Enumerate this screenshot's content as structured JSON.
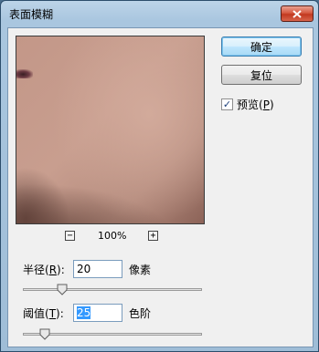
{
  "window": {
    "title": "表面模糊",
    "close_icon": "close-icon"
  },
  "preview": {
    "zoom_level": "100%",
    "zoom_out_label": "−",
    "zoom_in_label": "+"
  },
  "buttons": {
    "ok_label": "确定",
    "reset_label": "复位"
  },
  "preview_checkbox": {
    "label_prefix": "预览(",
    "mnemonic": "P",
    "label_suffix": ")",
    "checked": true
  },
  "radius": {
    "label_prefix": "半径(",
    "mnemonic": "R",
    "label_suffix": "):",
    "value": "20",
    "unit": "像素",
    "slider_fraction": 0.2
  },
  "threshold": {
    "label_prefix": "阈值(",
    "mnemonic": "T",
    "label_suffix": "):",
    "value": "25",
    "unit": "色阶",
    "slider_fraction": 0.1
  },
  "colors": {
    "titlebar": "#a9c6df",
    "close_button": "#c2391f",
    "dialog_background": "#f0f0f0",
    "selection": "#3399ff"
  }
}
